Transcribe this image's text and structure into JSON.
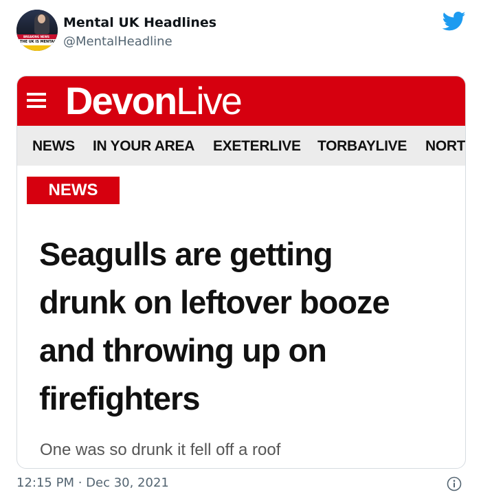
{
  "tweet": {
    "display_name": "Mental UK Headlines",
    "handle": "@MentalHeadline",
    "timestamp": "12:15 PM · Dec 30, 2021",
    "avatar_text": {
      "breaking": "BREAKING NEWS",
      "caption": "THE UK IS MENTAL"
    },
    "icons": {
      "brand": "twitter-bird-icon",
      "info": "info-icon"
    },
    "colors": {
      "twitter_blue": "#1d9bf0"
    }
  },
  "article": {
    "brand": {
      "strong": "Devon",
      "light": "Live"
    },
    "nav": [
      "NEWS",
      "IN YOUR AREA",
      "EXETERLIVE",
      "TORBAYLIVE",
      "NORT"
    ],
    "section_badge": "NEWS",
    "headline_lines": [
      "Seagulls are getting",
      "drunk on leftover booze",
      "and throwing up on",
      "firefighters"
    ],
    "standfirst": "One was so drunk it fell off a roof",
    "colors": {
      "brand_red": "#d6000f",
      "nav_bg": "#ececec"
    }
  }
}
